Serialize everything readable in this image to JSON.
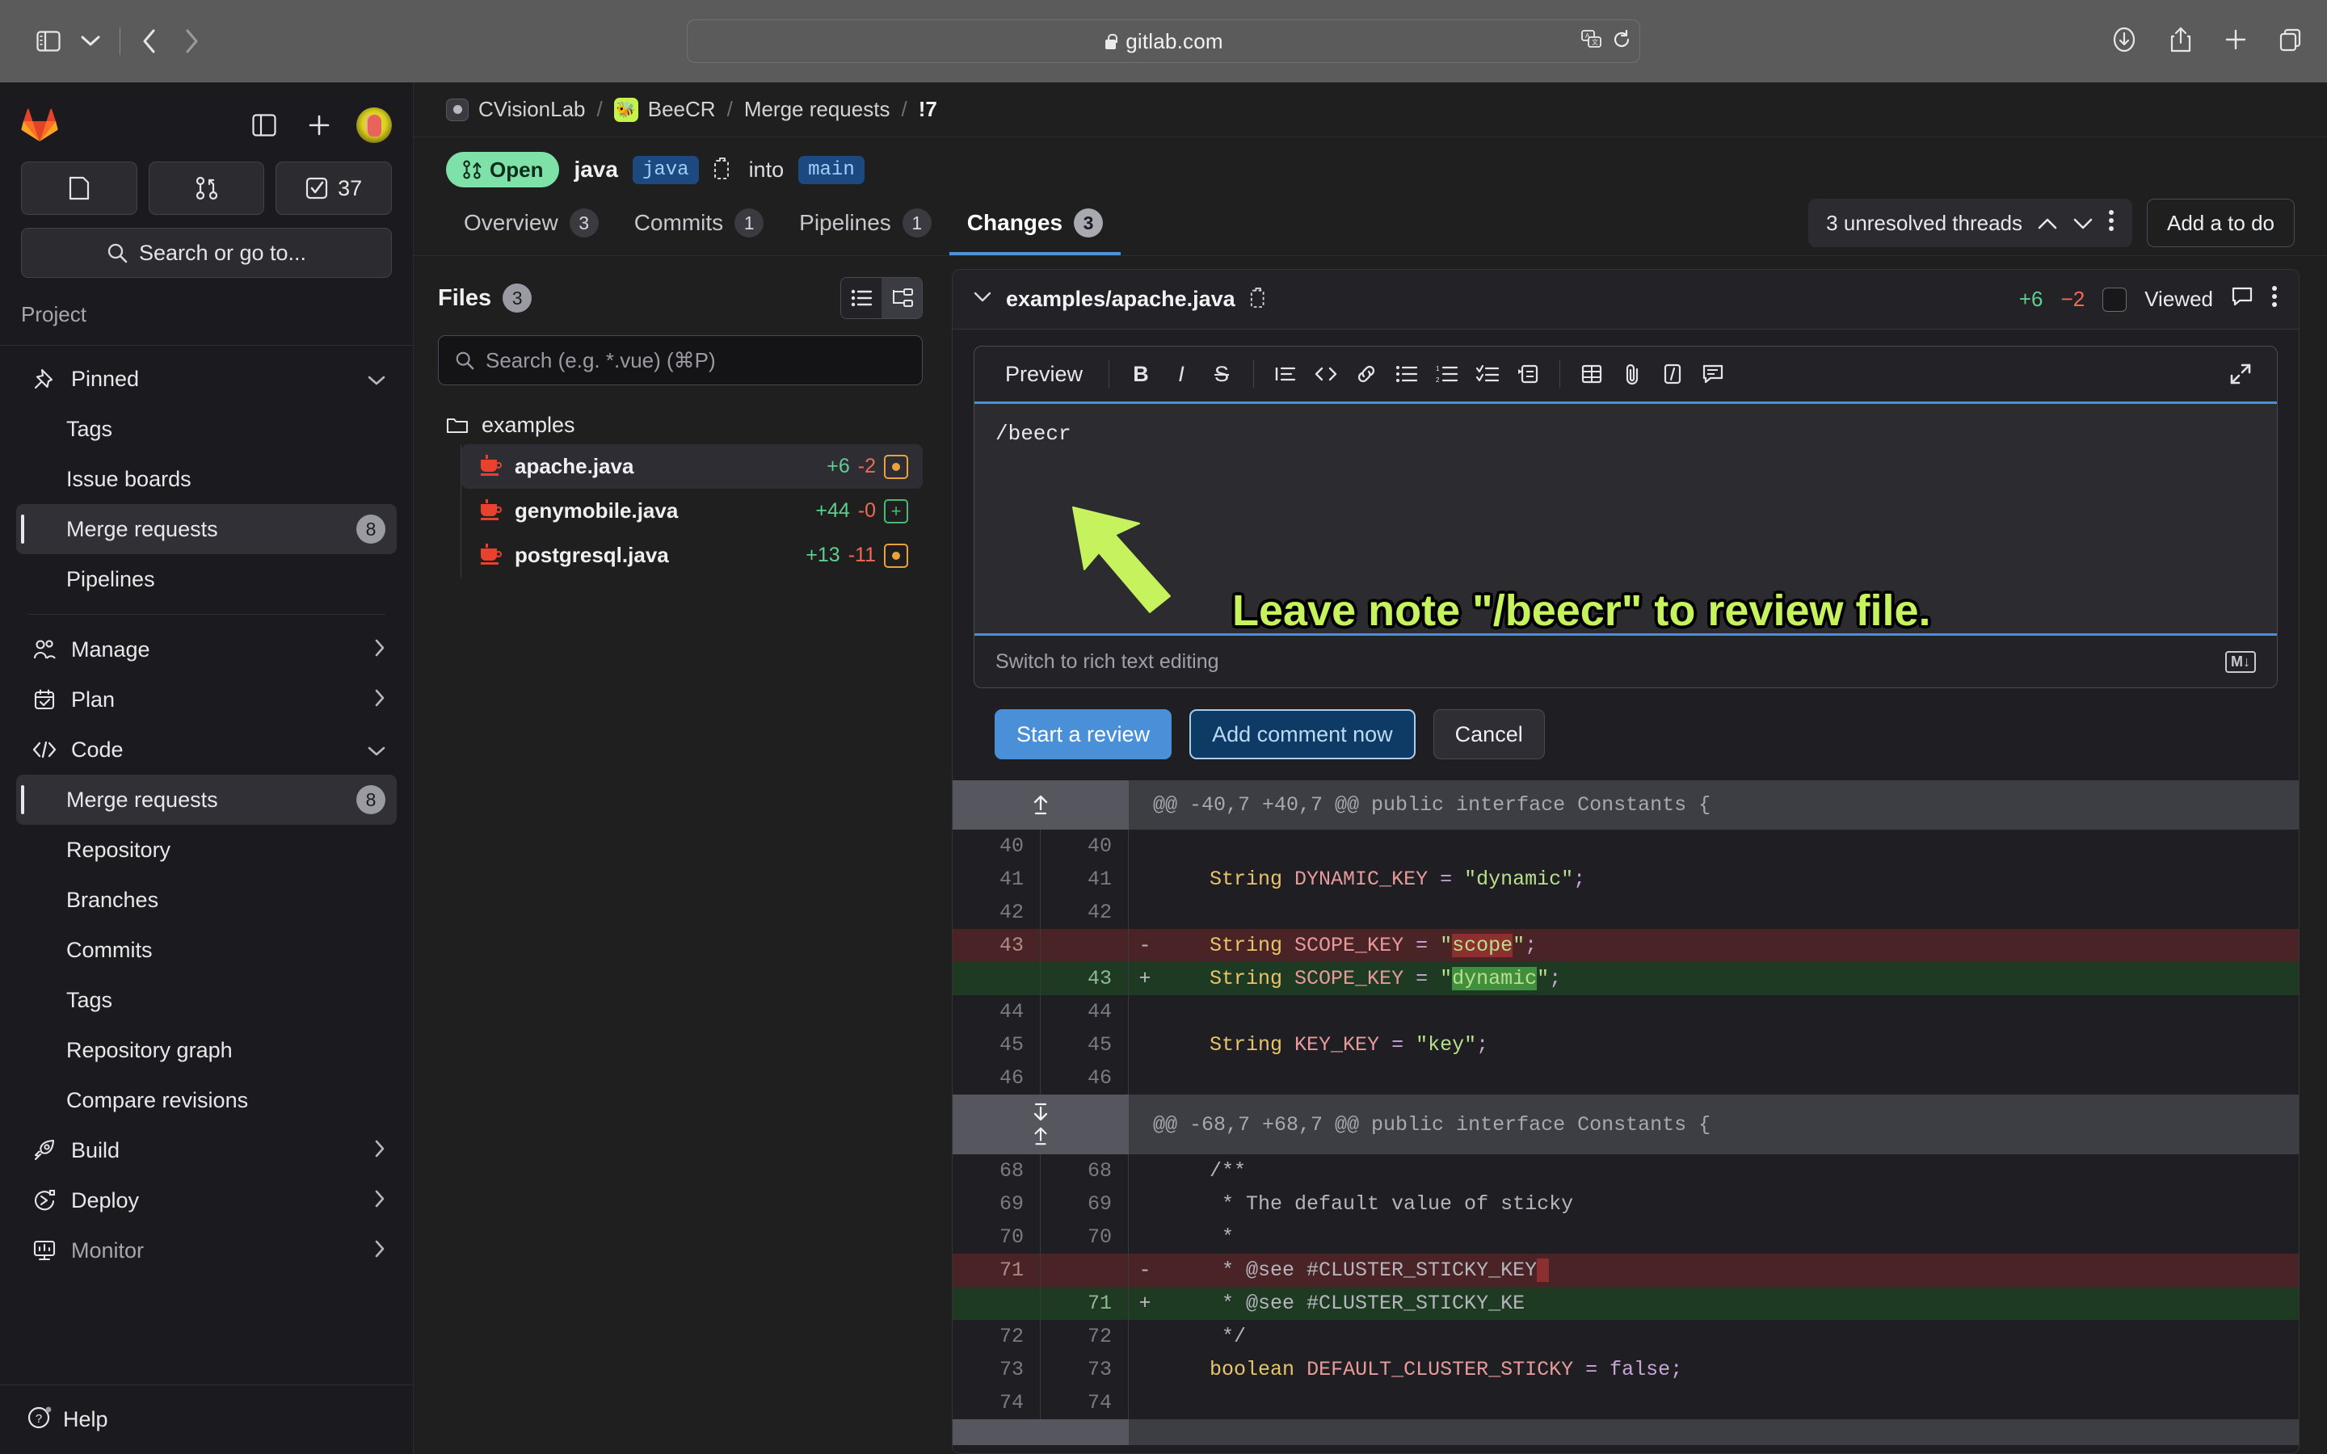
{
  "browser": {
    "url": "gitlab.com",
    "icons": [
      "sidebar-toggle-icon",
      "chevron-down-icon",
      "back-icon",
      "forward-icon",
      "translate-icon",
      "reload-icon",
      "downloads-icon",
      "share-icon",
      "new-tab-icon",
      "tabs-overview-icon"
    ]
  },
  "sidebar": {
    "quick_actions": [
      {
        "name": "issues",
        "icon": "issue-icon",
        "label": ""
      },
      {
        "name": "merge-requests",
        "icon": "merge-request-icon",
        "label": ""
      },
      {
        "name": "todos",
        "icon": "todo-check-icon",
        "label": "37"
      }
    ],
    "search_placeholder": "Search or go to...",
    "section_label": "Project",
    "groups": [
      {
        "label": "Pinned",
        "icon": "pin-icon",
        "expanded": true,
        "items": [
          {
            "label": "Tags",
            "badge": ""
          },
          {
            "label": "Issue boards",
            "badge": ""
          },
          {
            "label": "Merge requests",
            "badge": "8",
            "active": true
          },
          {
            "label": "Pipelines",
            "badge": ""
          }
        ]
      },
      {
        "label": "Manage",
        "icon": "users-icon",
        "expanded": false,
        "items": []
      },
      {
        "label": "Plan",
        "icon": "calendar-icon",
        "expanded": false,
        "items": []
      },
      {
        "label": "Code",
        "icon": "code-icon",
        "expanded": true,
        "items": [
          {
            "label": "Merge requests",
            "badge": "8",
            "active": true
          },
          {
            "label": "Repository",
            "badge": ""
          },
          {
            "label": "Branches",
            "badge": ""
          },
          {
            "label": "Commits",
            "badge": ""
          },
          {
            "label": "Tags",
            "badge": ""
          },
          {
            "label": "Repository graph",
            "badge": ""
          },
          {
            "label": "Compare revisions",
            "badge": ""
          }
        ]
      },
      {
        "label": "Build",
        "icon": "rocket-icon",
        "expanded": false,
        "items": []
      },
      {
        "label": "Deploy",
        "icon": "deploy-icon",
        "expanded": false,
        "items": []
      },
      {
        "label": "Monitor",
        "icon": "monitor-icon",
        "expanded": false,
        "items": []
      }
    ],
    "help_label": "Help"
  },
  "breadcrumb": {
    "group": "CVisionLab",
    "project": "BeeCR",
    "section": "Merge requests",
    "mr_ref": "!7"
  },
  "merge_request": {
    "state_label": "Open",
    "source_branch_title": "java",
    "source_branch_chip": "java",
    "into_word": "into",
    "target_branch_chip": "main"
  },
  "tabs": [
    {
      "label": "Overview",
      "badge": "3",
      "active": false
    },
    {
      "label": "Commits",
      "badge": "1",
      "active": false
    },
    {
      "label": "Pipelines",
      "badge": "1",
      "active": false
    },
    {
      "label": "Changes",
      "badge": "3",
      "active": true
    }
  ],
  "tabs_right": {
    "threads_label": "3 unresolved threads",
    "todo_button": "Add a to do"
  },
  "files_panel": {
    "title": "Files",
    "count": "3",
    "search_placeholder": "Search (e.g. *.vue) (⌘P)",
    "folder": "examples",
    "files": [
      {
        "name": "apache.java",
        "added": "+6",
        "removed": "-2",
        "status": "modified",
        "active": true
      },
      {
        "name": "genymobile.java",
        "added": "+44",
        "removed": "-0",
        "status": "added",
        "active": false
      },
      {
        "name": "postgresql.java",
        "added": "+13",
        "removed": "-11",
        "status": "modified",
        "active": false
      }
    ]
  },
  "diff_file": {
    "path": "examples/apache.java",
    "added": "+6",
    "removed": "−2",
    "viewed_label": "Viewed"
  },
  "editor": {
    "preview_label": "Preview",
    "toolbar_icons": [
      "bold-icon",
      "italic-icon",
      "strikethrough-icon",
      "quote-icon",
      "code-icon",
      "link-icon",
      "bulleted-list-icon",
      "numbered-list-icon",
      "checklist-icon",
      "indent-icon",
      "table-icon",
      "attachment-icon",
      "snippet-icon",
      "comment-template-icon",
      "expand-icon"
    ],
    "value": "/beecr",
    "footer_label": "Switch to rich text editing",
    "markdown_badge": "M↓",
    "buttons": {
      "start_review": "Start a review",
      "add_comment": "Add comment now",
      "cancel": "Cancel"
    }
  },
  "annotation": {
    "text": "Leave note \"/beecr\" to review file.",
    "color": "#c6f25e"
  },
  "diff": {
    "hunks": [
      {
        "header": "@@ -40,7 +40,7 @@ public interface Constants {",
        "expand": "up",
        "rows": [
          {
            "old": "40",
            "new": "40",
            "marker": "",
            "type": "ctx",
            "code": ""
          },
          {
            "old": "41",
            "new": "41",
            "marker": "",
            "type": "ctx",
            "code": "    String DYNAMIC_KEY = \"dynamic\";"
          },
          {
            "old": "42",
            "new": "42",
            "marker": "",
            "type": "ctx",
            "code": ""
          },
          {
            "old": "43",
            "new": "",
            "marker": "-",
            "type": "del",
            "code": "    String SCOPE_KEY = \"scope\";"
          },
          {
            "old": "",
            "new": "43",
            "marker": "+",
            "type": "add",
            "code": "    String SCOPE_KEY = \"dynamic\";"
          },
          {
            "old": "44",
            "new": "44",
            "marker": "",
            "type": "ctx",
            "code": ""
          },
          {
            "old": "45",
            "new": "45",
            "marker": "",
            "type": "ctx",
            "code": "    String KEY_KEY = \"key\";"
          },
          {
            "old": "46",
            "new": "46",
            "marker": "",
            "type": "ctx",
            "code": ""
          }
        ]
      },
      {
        "header": "@@ -68,7 +68,7 @@ public interface Constants {",
        "expand": "both",
        "rows": [
          {
            "old": "68",
            "new": "68",
            "marker": "",
            "type": "ctx",
            "code": "    /**"
          },
          {
            "old": "69",
            "new": "69",
            "marker": "",
            "type": "ctx",
            "code": "     * The default value of sticky"
          },
          {
            "old": "70",
            "new": "70",
            "marker": "",
            "type": "ctx",
            "code": "     *"
          },
          {
            "old": "71",
            "new": "",
            "marker": "-",
            "type": "del",
            "code": "     * @see #CLUSTER_STICKY_KEY"
          },
          {
            "old": "",
            "new": "71",
            "marker": "+",
            "type": "add",
            "code": "     * @see #CLUSTER_STICKY_KE"
          },
          {
            "old": "72",
            "new": "72",
            "marker": "",
            "type": "ctx",
            "code": "     */"
          },
          {
            "old": "73",
            "new": "73",
            "marker": "",
            "type": "ctx",
            "code": "    boolean DEFAULT_CLUSTER_STICKY = false;"
          },
          {
            "old": "74",
            "new": "74",
            "marker": "",
            "type": "ctx",
            "code": ""
          }
        ]
      }
    ]
  }
}
